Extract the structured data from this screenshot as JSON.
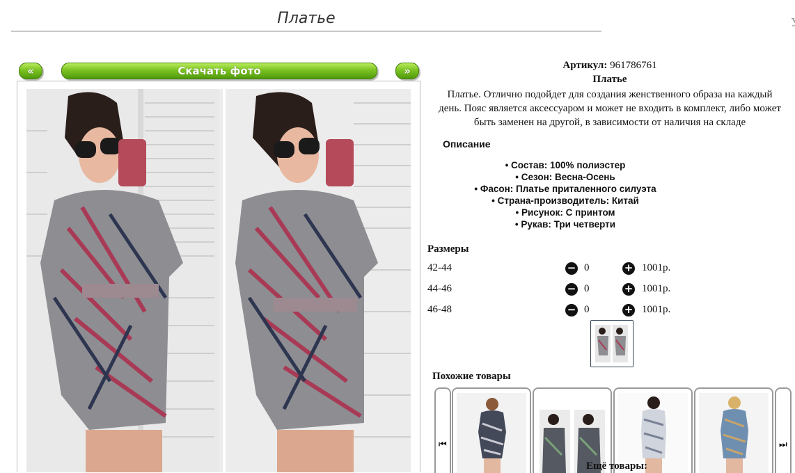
{
  "header": {
    "title": "Платье",
    "edge_char": "У"
  },
  "nav": {
    "prev": "«",
    "next": "»",
    "download": "Скачать фото"
  },
  "product": {
    "article_label": "Артикул:",
    "article_value": "961786761",
    "name": "Платье",
    "description_lines": [
      "Платье. Отлично подойдет для создания женственного образа на каждый",
      "день. Пояс является аксессуаром и может не входить в комплект, либо может",
      "быть заменен на другой, в зависимости от наличия на складе"
    ],
    "opis_heading": "Описание",
    "properties": [
      "Состав: 100% полиэстер",
      "Сезон: Весна-Осень",
      "Фасон: Платье приталенного силуэта",
      "Страна-производитель: Китай",
      "Рисунок: С принтом",
      "Рукав: Три четверти"
    ]
  },
  "sizes": {
    "heading": "Размеры",
    "rows": [
      {
        "size": "42-44",
        "qty": "0",
        "price": "1001р."
      },
      {
        "size": "44-46",
        "qty": "0",
        "price": "1001р."
      },
      {
        "size": "46-48",
        "qty": "0",
        "price": "1001р."
      }
    ]
  },
  "similar": {
    "heading": "Похожие товары",
    "more": "Ещё товары:"
  },
  "colors": {
    "accent_green": "#7cc222",
    "dress_red": "#a83a55",
    "hair": "#2a1e1a"
  }
}
